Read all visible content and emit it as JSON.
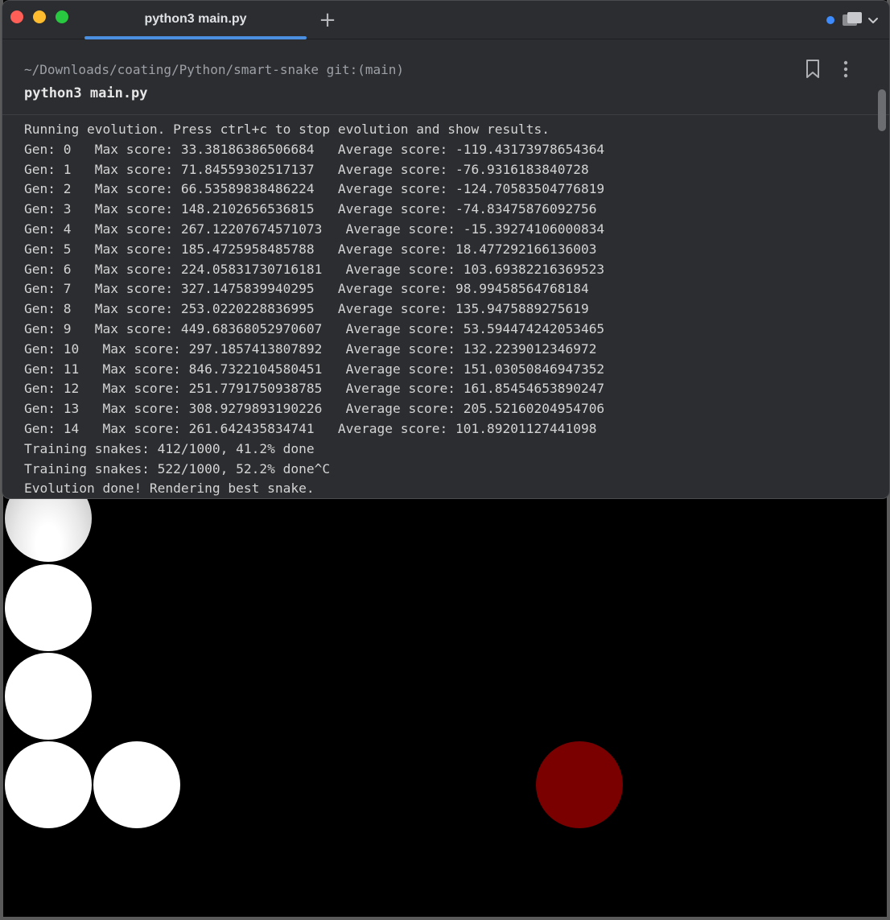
{
  "window": {
    "tab_label": "python3 main.py",
    "new_tab_symbol": "+"
  },
  "prompt": {
    "cwd": "~/Downloads/coating/Python/smart-snake git:(main)",
    "command": "python3 main.py"
  },
  "output_lines": [
    "Running evolution. Press ctrl+c to stop evolution and show results.",
    "Gen: 0   Max score: 33.38186386506684   Average score: -119.43173978654364",
    "Gen: 1   Max score: 71.84559302517137   Average score: -76.9316183840728",
    "Gen: 2   Max score: 66.53589838486224   Average score: -124.70583504776819",
    "Gen: 3   Max score: 148.2102656536815   Average score: -74.83475876092756",
    "Gen: 4   Max score: 267.12207674571073   Average score: -15.39274106000834",
    "Gen: 5   Max score: 185.4725958485788   Average score: 18.477292166136003",
    "Gen: 6   Max score: 224.05831730716181   Average score: 103.69382216369523",
    "Gen: 7   Max score: 327.1475839940295   Average score: 98.99458564768184",
    "Gen: 8   Max score: 253.0220228836995   Average score: 135.9475889275619",
    "Gen: 9   Max score: 449.68368052970607   Average score: 53.594474242053465",
    "Gen: 10   Max score: 297.1857413807892   Average score: 132.2239012346972",
    "Gen: 11   Max score: 846.7322104580451   Average score: 151.03050846947352",
    "Gen: 12   Max score: 251.7791750938785   Average score: 161.85454653890247",
    "Gen: 13   Max score: 308.9279893190226   Average score: 205.52160204954706",
    "Gen: 14   Max score: 261.642435834741   Average score: 101.89201127441098",
    "Training snakes: 412/1000, 41.2% done",
    "Training snakes: 522/1000, 52.2% done^C",
    "Evolution done! Rendering best snake."
  ],
  "game": {
    "snake_color": "#ffffff",
    "food_color": "#7a0000",
    "background_color": "#000000"
  },
  "colors": {
    "accent": "#4a8fe0",
    "terminal_bg": "#2b2d30",
    "traffic_red": "#ff5f57",
    "traffic_yellow": "#febc2e",
    "traffic_green": "#28c840"
  }
}
